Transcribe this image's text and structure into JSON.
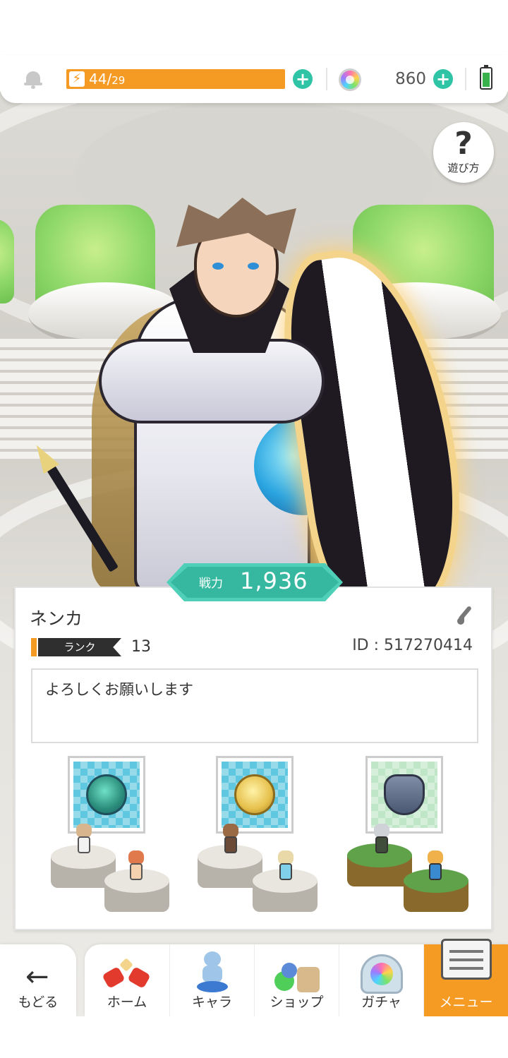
{
  "status": {
    "stamina_current": "44",
    "stamina_sep": "/",
    "stamina_max": "29",
    "stamina_fraction": 1.0,
    "gems": "860",
    "battery_level": 0.7
  },
  "help": {
    "icon": "?",
    "label": "遊び方"
  },
  "power": {
    "label": "戦力",
    "value": "1,936"
  },
  "profile": {
    "name": "ネンカ",
    "rank_label": "ランク",
    "rank_value": "13",
    "id_text": "ID : 517270414",
    "greeting": "よろしくお願いします"
  },
  "nav": {
    "back": "もどる",
    "items": [
      {
        "label": "ホーム",
        "icon": "home-icon"
      },
      {
        "label": "キャラ",
        "icon": "character-icon"
      },
      {
        "label": "ショップ",
        "icon": "shop-icon"
      },
      {
        "label": "ガチャ",
        "icon": "gacha-icon"
      },
      {
        "label": "メニュー",
        "icon": "menu-icon",
        "active": true
      }
    ]
  },
  "colors": {
    "accent_orange": "#f59a23",
    "teal": "#35b89f",
    "plus_green": "#2ec4a5"
  }
}
